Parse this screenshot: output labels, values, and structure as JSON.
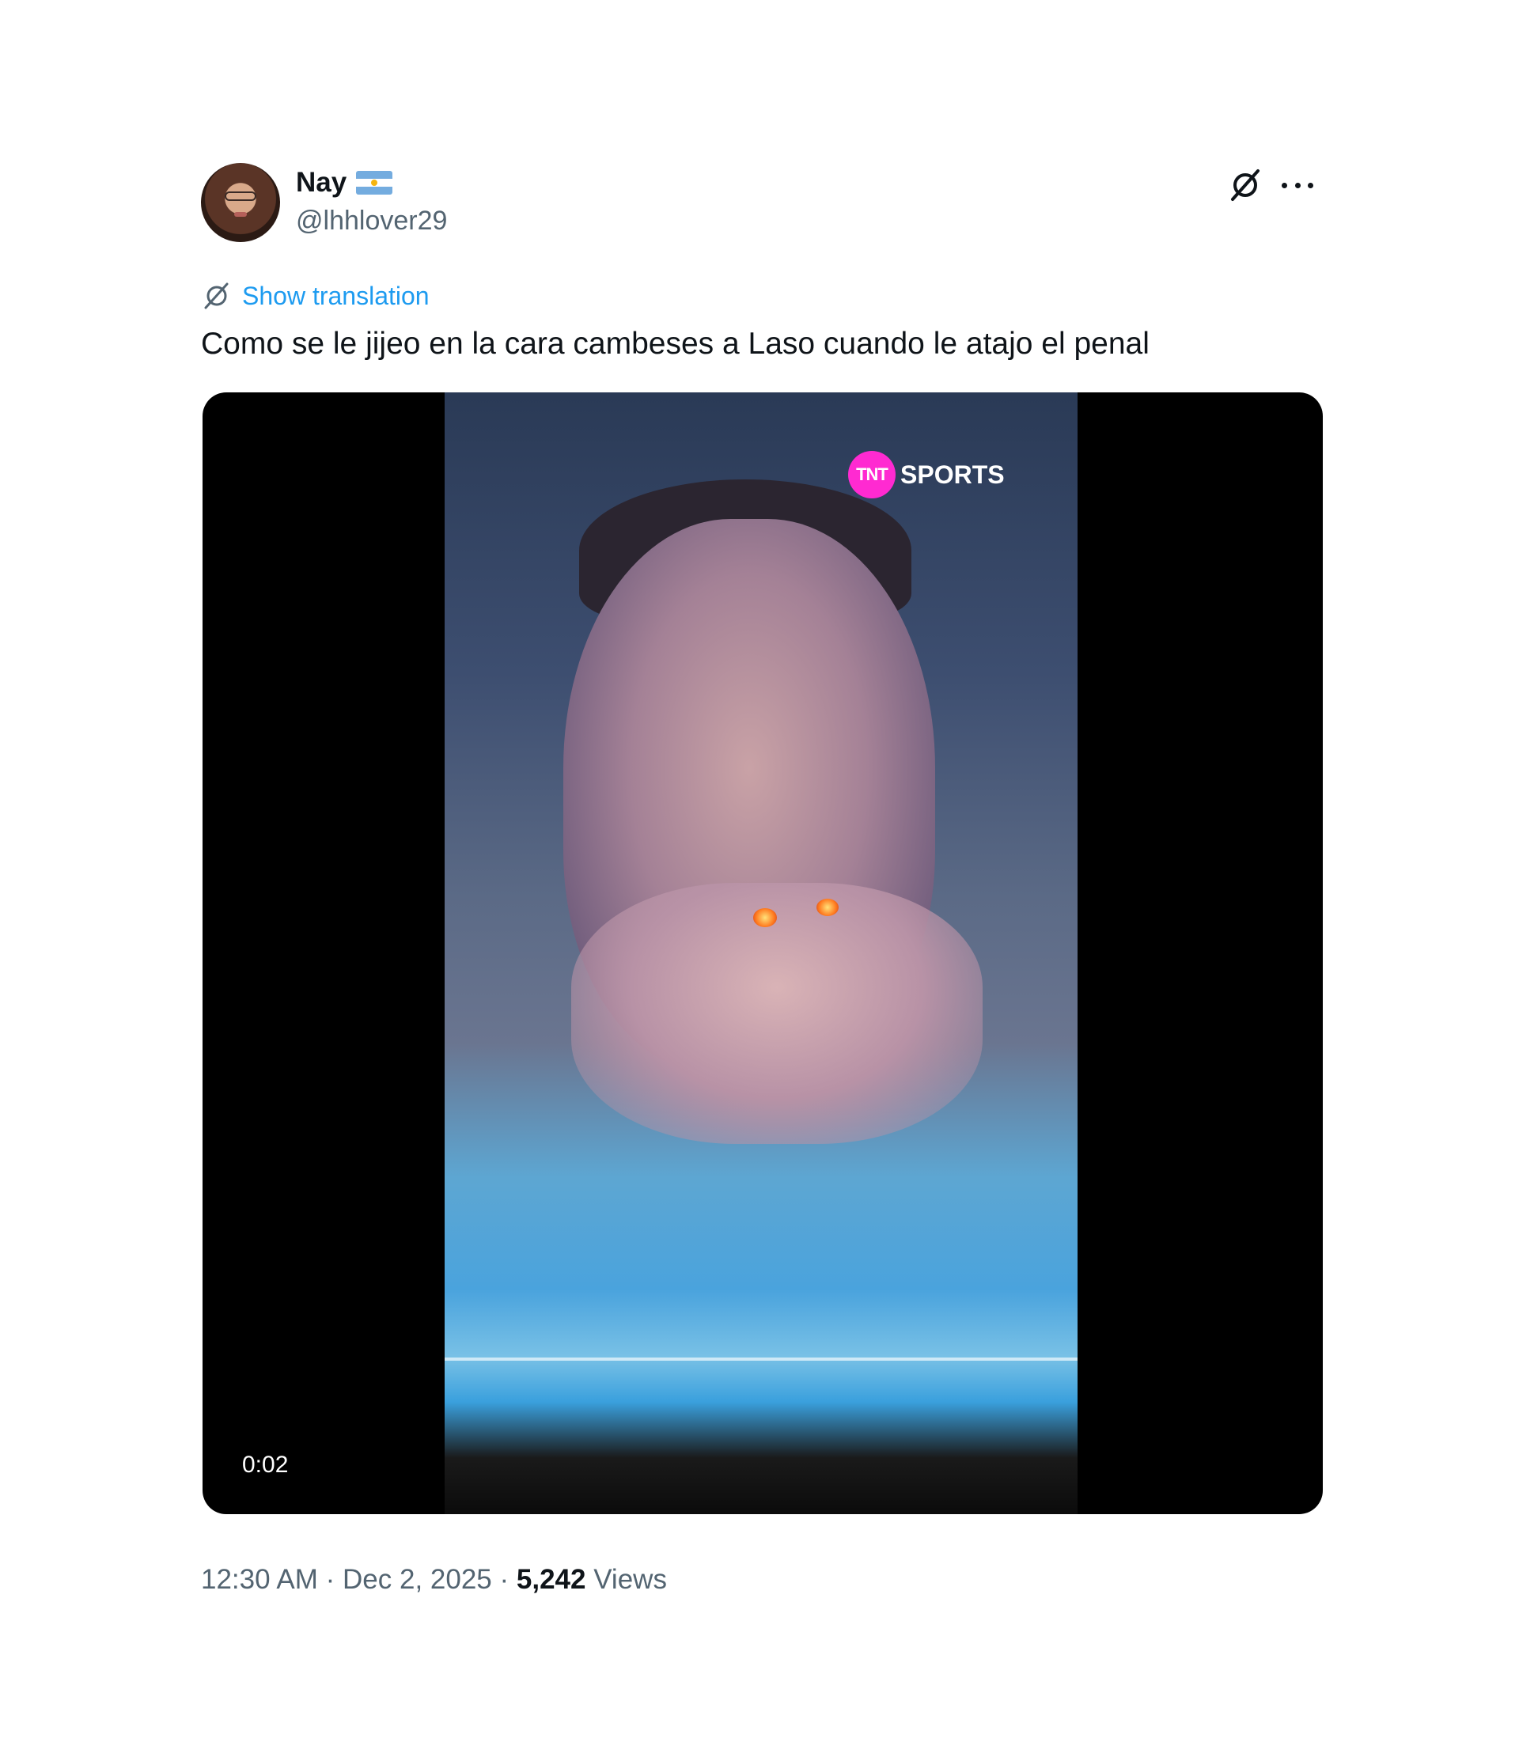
{
  "author": {
    "display_name": "Nay",
    "flag_icon": "argentina-flag-icon",
    "handle": "@lhhlover29"
  },
  "actions": {
    "grok_icon": "grok-icon",
    "more_icon": "more-options-icon"
  },
  "translation": {
    "label": "Show translation",
    "icon": "grok-icon"
  },
  "tweet": {
    "text": "Como se le jijeo en la cara cambeses a Laso cuando le atajo el penal"
  },
  "media": {
    "type": "video",
    "overlay_logo": {
      "badge": "TNT",
      "word": "SPORTS"
    },
    "duration": "0:02"
  },
  "meta": {
    "time": "12:30 AM",
    "separator": "·",
    "date": "Dec 2, 2025",
    "views_count": "5,242",
    "views_label": "Views"
  },
  "colors": {
    "link": "#1d9bf0",
    "secondary_text": "#536471",
    "primary_text": "#0f1419",
    "tnt_pink": "#ff2ad1"
  }
}
